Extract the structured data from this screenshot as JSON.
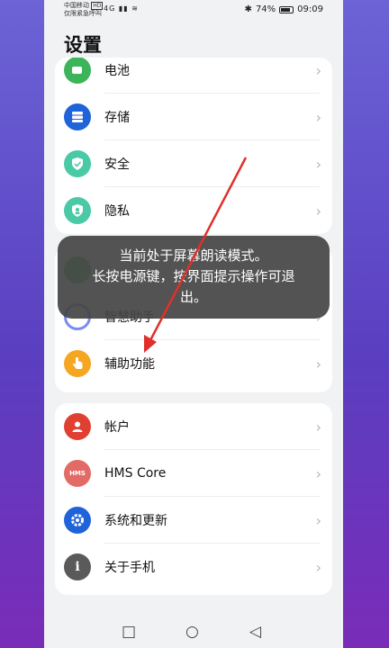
{
  "status": {
    "carrier_line1": "中国移动",
    "carrier_badge": "HD",
    "carrier_line2": "仅限紧急呼叫",
    "signal": "4G",
    "battery_percent": "74%",
    "time": "09:09"
  },
  "title": "设置",
  "group1": [
    {
      "label": "电池",
      "icon": "battery-icon",
      "color": "#3cb55a"
    },
    {
      "label": "存储",
      "icon": "storage-icon",
      "color": "#1e63d9"
    },
    {
      "label": "安全",
      "icon": "shield-icon",
      "color": "#49c9a6"
    },
    {
      "label": "隐私",
      "icon": "privacy-icon",
      "color": "#49c9a6"
    }
  ],
  "group2": [
    {
      "label": "智慧助手",
      "icon": "assistant-icon",
      "color": "#7a8cf0"
    },
    {
      "label": "辅助功能",
      "icon": "accessibility-icon",
      "color": "#f5a623"
    }
  ],
  "group3": [
    {
      "label": "帐户",
      "icon": "account-icon",
      "color": "#e04032"
    },
    {
      "label": "HMS Core",
      "icon": "hms-icon",
      "badge": "HMS",
      "color": "#e36b67"
    },
    {
      "label": "系统和更新",
      "icon": "gear-icon",
      "color": "#1e63d9"
    },
    {
      "label": "关于手机",
      "icon": "info-icon",
      "color": "#5a5a5a"
    }
  ],
  "toast": {
    "line1": "当前处于屏幕朗读模式。",
    "line2": "长按电源键，按界面提示操作可退",
    "line3": "出。"
  },
  "nav": {
    "recent": "□",
    "home": "○",
    "back": "◁"
  }
}
